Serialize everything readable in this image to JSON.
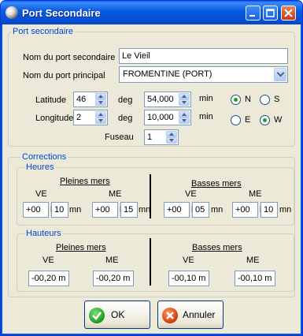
{
  "window": {
    "title": "Port Secondaire"
  },
  "port_section": {
    "label": "Port secondaire",
    "secondary_port_label": "Nom du port secondaire",
    "secondary_port_value": "Le Vieil",
    "principal_port_label": "Nom du port principal",
    "principal_port_value": "FROMENTINE (PORT)",
    "latitude_label": "Latitude",
    "latitude_deg": "46",
    "latitude_min": "54,000",
    "longitude_label": "Longitude",
    "longitude_deg": "2",
    "longitude_min": "10,000",
    "deg_label": "deg",
    "min_label": "min",
    "fuseau_label": "Fuseau",
    "fuseau_value": "1",
    "north_label": "N",
    "south_label": "S",
    "east_label": "E",
    "west_label": "W",
    "lat_selected": "N",
    "lon_selected": "W"
  },
  "corrections": {
    "label": "Corrections",
    "heures": {
      "label": "Heures",
      "pleines_label": "Pleines mers",
      "basses_label": "Basses mers",
      "ve_label": "VE",
      "me_label": "ME",
      "h_label": "h",
      "mn_label": "mn",
      "pleines_ve_sign": "+00",
      "pleines_ve_min": "10",
      "pleines_me_sign": "+00",
      "pleines_me_min": "15",
      "basses_ve_sign": "+00",
      "basses_ve_min": "05",
      "basses_me_sign": "+00",
      "basses_me_min": "10"
    },
    "hauteurs": {
      "label": "Hauteurs",
      "pleines_label": "Pleines mers",
      "basses_label": "Basses mers",
      "ve_label": "VE",
      "me_label": "ME",
      "pleines_ve": "-00,20 m",
      "pleines_me": "-00,20 m",
      "basses_ve": "-00,10 m",
      "basses_me": "-00,10 m"
    }
  },
  "buttons": {
    "ok": "OK",
    "cancel": "Annuler"
  },
  "colors": {
    "title_blue": "#0054e3",
    "group_label": "#0046d5",
    "radio_dot": "#21a121"
  }
}
